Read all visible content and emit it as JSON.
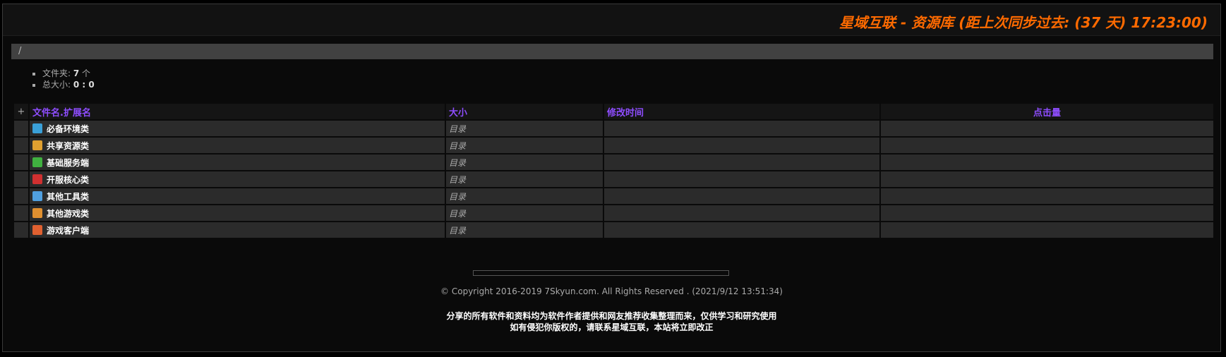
{
  "header": {
    "title": "星域互联 - 资源库 (距上次同步过去: (37 天) 17:23:00)"
  },
  "breadcrumb": {
    "path": "/"
  },
  "stats": {
    "folders_label": "文件夹: ",
    "folders_value": "7",
    "folders_unit": " 个",
    "size_label": "总大小: ",
    "size_value": "0 : 0"
  },
  "table": {
    "plus": "+",
    "headers": {
      "name": "文件名.扩展名",
      "size": "大小",
      "mtime": "修改时间",
      "hits": "点击量"
    },
    "rows": [
      {
        "name": "必备环境类",
        "type": "目录",
        "icon": "env-icon",
        "color": "#3aa0d8"
      },
      {
        "name": "共享资源类",
        "type": "目录",
        "icon": "share-icon",
        "color": "#e0a030"
      },
      {
        "name": "基础服务端",
        "type": "目录",
        "icon": "server-icon",
        "color": "#40b040"
      },
      {
        "name": "开服核心类",
        "type": "目录",
        "icon": "core-icon",
        "color": "#d03030"
      },
      {
        "name": "其他工具类",
        "type": "目录",
        "icon": "tools-icon",
        "color": "#50a0e0"
      },
      {
        "name": "其他游戏类",
        "type": "目录",
        "icon": "game-icon",
        "color": "#e09030"
      },
      {
        "name": "游戏客户端",
        "type": "目录",
        "icon": "client-icon",
        "color": "#e06030"
      }
    ]
  },
  "footer": {
    "copyright": "© Copyright 2016-2019 7Skyun.com. All Rights Reserved . (2021/9/12 13:51:34)",
    "notice_line1": "分享的所有软件和资料均为软件作者提供和网友推荐收集整理而来，仅供学习和研究使用",
    "notice_line2": "如有侵犯你版权的，请联系星域互联，本站将立即改正"
  }
}
